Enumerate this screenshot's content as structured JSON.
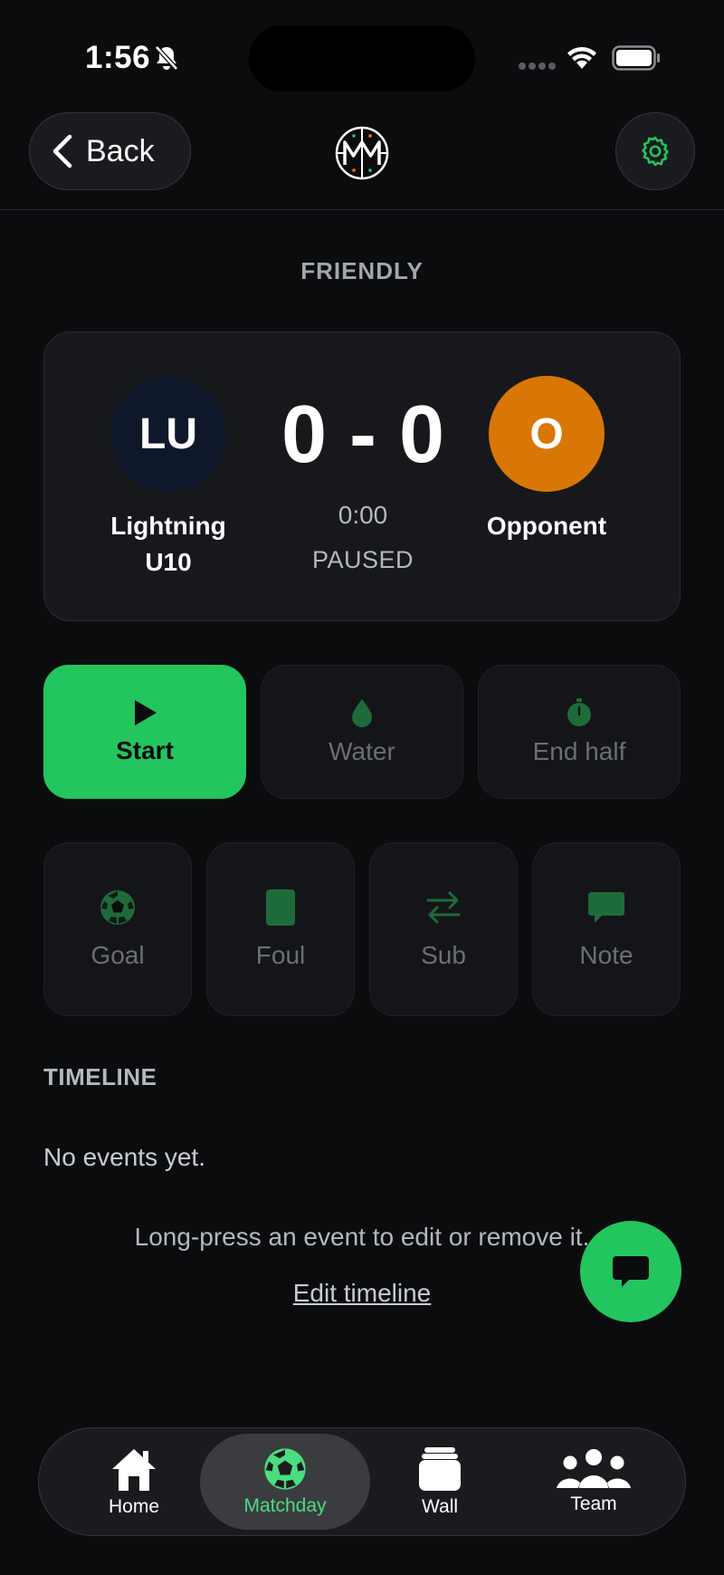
{
  "status_bar": {
    "time": "1:56"
  },
  "header": {
    "back_label": "Back"
  },
  "match": {
    "type": "FRIENDLY",
    "home": {
      "initials": "LU",
      "name_line1": "Lightning",
      "name_line2": "U10",
      "color": "#0f172a"
    },
    "away": {
      "initials": "O",
      "name": "Opponent",
      "color": "#d97706"
    },
    "score": "0 - 0",
    "clock": "0:00",
    "state": "PAUSED"
  },
  "controls": {
    "start": "Start",
    "water": "Water",
    "end_half": "End half"
  },
  "events": {
    "goal": "Goal",
    "foul": "Foul",
    "sub": "Sub",
    "note": "Note"
  },
  "timeline": {
    "title": "TIMELINE",
    "empty": "No events yet.",
    "hint": "Long-press an event to edit or remove it.",
    "edit_link": "Edit timeline"
  },
  "tabs": [
    {
      "label": "Home"
    },
    {
      "label": "Matchday"
    },
    {
      "label": "Wall"
    },
    {
      "label": "Team"
    }
  ],
  "colors": {
    "accent": "#22c55e",
    "accent_light": "#4ade80",
    "dim_icon": "#1e6b3a",
    "background": "#0b0c0e"
  }
}
